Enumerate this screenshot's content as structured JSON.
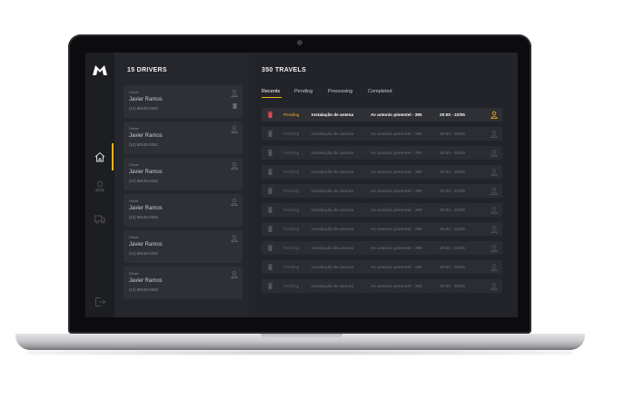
{
  "colors": {
    "accent": "#f2b318",
    "delete_active": "#e5484d",
    "background": "#232429",
    "card": "#2f3036"
  },
  "sidebar": {
    "icons": [
      "logo-m",
      "home-icon",
      "user-icon",
      "truck-icon",
      "logout-icon"
    ],
    "active_item": "home-icon"
  },
  "drivers": {
    "title": "15 DRIVERS",
    "items": [
      {
        "role": "Driver",
        "name": "Javier Ramos",
        "phone": "(12) 98145-0253"
      },
      {
        "role": "Driver",
        "name": "Javier Ramos",
        "phone": "(12) 98145-0253"
      },
      {
        "role": "Driver",
        "name": "Javier Ramos",
        "phone": "(12) 98145-0253"
      },
      {
        "role": "Driver",
        "name": "Javier Ramos",
        "phone": "(12) 98145-0253"
      },
      {
        "role": "Driver",
        "name": "Javier Ramos",
        "phone": "(12) 98145-0253"
      },
      {
        "role": "Driver",
        "name": "Javier Ramos",
        "phone": "(12) 98145-0253"
      }
    ]
  },
  "travels": {
    "title": "350 TRAVELS",
    "tabs": [
      "Recents",
      "Pending",
      "Processing",
      "Completed"
    ],
    "active_tab": "Recents",
    "rows": [
      {
        "status": "Pending",
        "service": "Instalação de antena",
        "address": "Av antonio pimentel - 390",
        "time": "20:00 - 22/05",
        "active": true
      },
      {
        "status": "Pending",
        "service": "Instalação de antena",
        "address": "Av antonio pimentel - 390",
        "time": "20:00 - 22/05",
        "active": false
      },
      {
        "status": "Pending",
        "service": "Instalação de antena",
        "address": "Av antonio pimentel - 390",
        "time": "20:00 - 22/05",
        "active": false
      },
      {
        "status": "Pending",
        "service": "Instalação de antena",
        "address": "Av antonio pimentel - 390",
        "time": "20:00 - 22/05",
        "active": false
      },
      {
        "status": "Pending",
        "service": "Instalação de antena",
        "address": "Av antonio pimentel - 390",
        "time": "20:00 - 22/05",
        "active": false
      },
      {
        "status": "Pending",
        "service": "Instalação de antena",
        "address": "Av antonio pimentel - 390",
        "time": "20:00 - 22/05",
        "active": false
      },
      {
        "status": "Pending",
        "service": "Instalação de antena",
        "address": "Av antonio pimentel - 390",
        "time": "20:00 - 22/05",
        "active": false
      },
      {
        "status": "Pending",
        "service": "Instalação de antena",
        "address": "Av antonio pimentel - 390",
        "time": "20:00 - 22/05",
        "active": false
      },
      {
        "status": "Pending",
        "service": "Instalação de antena",
        "address": "Av antonio pimentel - 390",
        "time": "20:00 - 22/05",
        "active": false
      },
      {
        "status": "Pending",
        "service": "Instalação de antena",
        "address": "Av antonio pimentel - 390",
        "time": "20:00 - 22/05",
        "active": false
      }
    ]
  }
}
